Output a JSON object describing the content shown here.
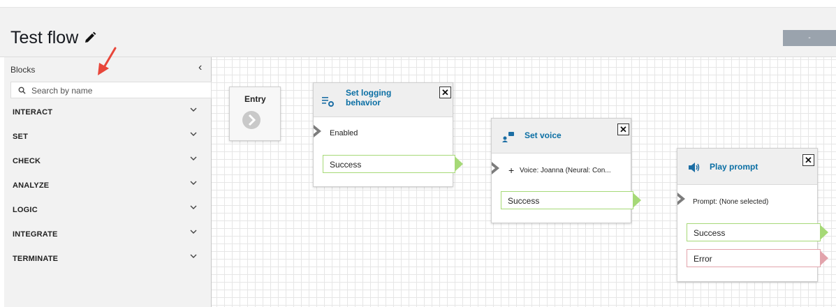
{
  "header": {
    "title": "Test flow",
    "action_label": "-"
  },
  "sidebar": {
    "header_label": "Blocks",
    "search_placeholder": "Search by name",
    "categories": [
      "INTERACT",
      "SET",
      "CHECK",
      "ANALYZE",
      "LOGIC",
      "INTEGRATE",
      "TERMINATE"
    ]
  },
  "blocks": {
    "entry": {
      "title": "Entry"
    },
    "logging": {
      "title_line1": "Set logging",
      "title_line2": "behavior",
      "close": "✕",
      "status": "Enabled",
      "success": "Success"
    },
    "voice": {
      "title": "Set voice",
      "close": "✕",
      "plus": "+",
      "detail": "Voice: Joanna (Neural: Con...",
      "success": "Success"
    },
    "prompt": {
      "title": "Play prompt",
      "close": "✕",
      "detail": "Prompt: (None selected)",
      "success": "Success",
      "error": "Error"
    }
  },
  "colors": {
    "accent_title": "#0b6fa4",
    "success_border": "#a6d977",
    "error_border": "#e2a3ab",
    "annotation_arrow": "#e8463a"
  },
  "icons": [
    "pencil-icon",
    "collapse-chevron-icon",
    "search-icon",
    "chevron-down-icon",
    "logging-icon",
    "voice-icon",
    "speaker-icon",
    "annotation-arrow"
  ]
}
